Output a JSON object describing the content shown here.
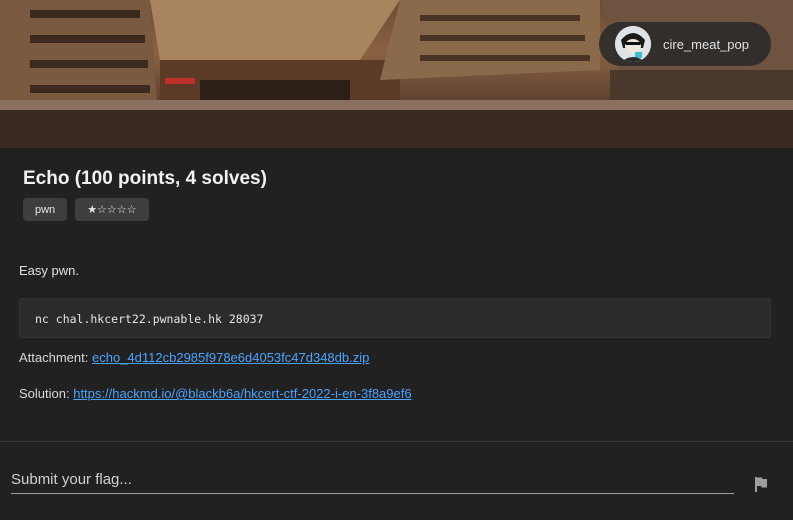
{
  "header": {
    "user": {
      "name": "cire_meat_pop",
      "avatar_icon": "avatar-character-icon"
    }
  },
  "challenge": {
    "title": "Echo (100 points, 4 solves)",
    "tags": [
      "pwn",
      "★☆☆☆☆"
    ],
    "difficulty": 1,
    "description": "Easy pwn.",
    "command": "nc chal.hkcert22.pwnable.hk 28037",
    "attachment_label": "Attachment:",
    "attachment_link": "echo_4d112cb2985f978e6d4053fc47d348db.zip",
    "solution_label": "Solution:",
    "solution_link": "https://hackmd.io/@blackb6a/hkcert-ctf-2022-i-en-3f8a9ef6"
  },
  "flag_form": {
    "placeholder": "Submit your flag...",
    "submit_icon": "flag-icon"
  },
  "colors": {
    "background": "#212121",
    "link": "#4aa3ff",
    "chip": "#3e3e3e"
  }
}
